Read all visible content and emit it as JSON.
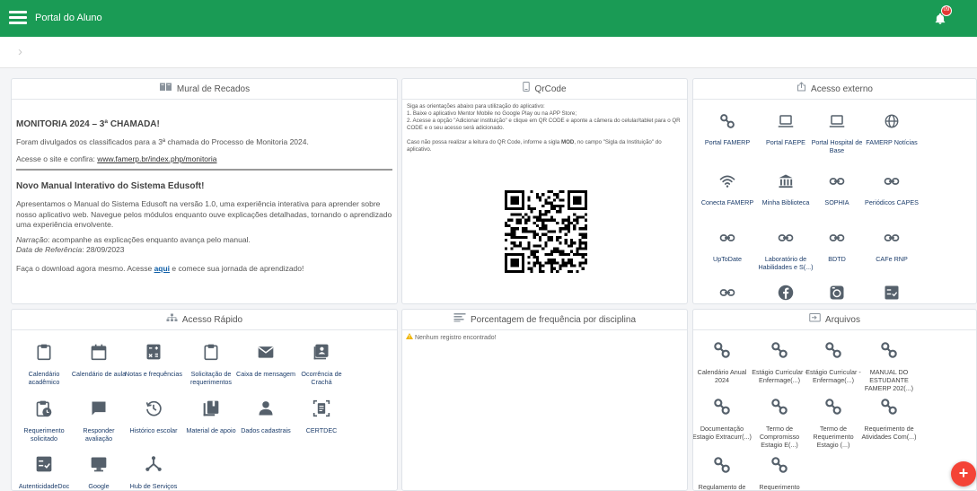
{
  "app": {
    "title": "Portal do Aluno",
    "notification_count": "09"
  },
  "mural": {
    "title": "Mural de Recados",
    "post1_title": "MONITORIA 2024 – 3ª CHAMADA!",
    "post1_body": "Foram divulgados os classificados para a 3ª chamada do Processo de Monitoria 2024.",
    "post1_link_prefix": "Acesse o site e confira: ",
    "post1_link": "www.famerp.br/index.php/monitoria",
    "post2_title": "Novo Manual Interativo do Sistema Edusoft!",
    "post2_body": "Apresentamos o Manual do Sistema Edusoft na versão 1.0, uma experiência interativa para aprender sobre nosso aplicativo web. Navegue pelos módulos enquanto ouve explicações detalhadas, tornando o aprendizado uma experiência envolvente.",
    "post2_narracao_label": "Narração",
    "post2_narracao": ": acompanhe as explicações enquanto avança pelo manual.",
    "post2_data_label": "Data de Referência",
    "post2_data": ": 28/09/2023",
    "post2_download_prefix": "Faça o download agora mesmo. Acesse ",
    "post2_download_link": "aqui",
    "post2_download_suffix": " e comece sua jornada de aprendizado!"
  },
  "qrcode": {
    "title": "QrCode",
    "line1": "Siga as orientações abaixo para utilização do aplicativo:",
    "line2": "1. Baixe o aplicativo Mentor Mobile no Google Play ou na APP Store;",
    "line3": "2. Acesse a opção \"Adicionar instituição\" e clique em QR CODE e aponte a câmera do celular/tablet para o QR CODE e o seu acesso será adicionado.",
    "line4_prefix": "Caso não possa realizar a leitura do QR Code, informe a sigla ",
    "line4_sigla": "MOD",
    "line4_suffix": ", no campo \"Sigla da Instituição\" do aplicativo."
  },
  "acesso_externo": {
    "title": "Acesso externo",
    "items": [
      {
        "label": "Portal FAMERP",
        "icon": "link-icon"
      },
      {
        "label": "Portal FAEPE",
        "icon": "laptop-icon"
      },
      {
        "label": "Portal Hospital de Base",
        "icon": "laptop-icon"
      },
      {
        "label": "FAMERP Notícias",
        "icon": "globe-icon"
      },
      {
        "label": "Conecta FAMERP",
        "icon": "wifi-icon"
      },
      {
        "label": "Minha Biblioteca",
        "icon": "bank-icon"
      },
      {
        "label": "SOPHIA",
        "icon": "chain-icon"
      },
      {
        "label": "Periódicos CAPES",
        "icon": "chain-icon"
      },
      {
        "label": "UpToDate",
        "icon": "chain-icon"
      },
      {
        "label": "Laboratório de Habilidades e S(...)",
        "icon": "chain-icon"
      },
      {
        "label": "BDTD",
        "icon": "chain-icon"
      },
      {
        "label": "CAFe RNP",
        "icon": "chain-icon"
      },
      {
        "label": "",
        "icon": "chain-icon"
      },
      {
        "label": "",
        "icon": "facebook-icon"
      },
      {
        "label": "",
        "icon": "instagram-icon"
      },
      {
        "label": "",
        "icon": "checklist-icon"
      }
    ]
  },
  "acesso_rapido": {
    "title": "Acesso Rápido",
    "items": [
      {
        "label": "Calendário acadêmico",
        "icon": "clipboard-icon"
      },
      {
        "label": "Calendário de aula",
        "icon": "calendar-icon"
      },
      {
        "label": "Notas e frequências",
        "icon": "calculator-icon"
      },
      {
        "label": "Solicitação de requerimentos",
        "icon": "clipboard-icon"
      },
      {
        "label": "Caixa de mensagem",
        "icon": "mail-icon"
      },
      {
        "label": "Ocorrência de Crachá",
        "icon": "badge-icon"
      },
      {
        "label": "Requerimento solicitado",
        "icon": "clipboard-clock-icon"
      },
      {
        "label": "Responder avaliação",
        "icon": "chat-icon"
      },
      {
        "label": "Histórico escolar",
        "icon": "history-icon"
      },
      {
        "label": "Material de apoio",
        "icon": "books-icon"
      },
      {
        "label": "Dados cadastrais",
        "icon": "person-icon"
      },
      {
        "label": "CERTDEC",
        "icon": "certificate-icon"
      },
      {
        "label": "AutenticidadeDoc",
        "icon": "checklist-icon"
      },
      {
        "label": "Google",
        "icon": "monitor-icon"
      },
      {
        "label": "Hub de Serviços",
        "icon": "hub-icon"
      }
    ]
  },
  "frequencia": {
    "title": "Porcentagem de frequência por disciplina",
    "empty_message": "Nenhum registro encontrado!"
  },
  "arquivos": {
    "title": "Arquivos",
    "items": [
      {
        "label": "Calendário Anual 2024",
        "icon": "link-icon"
      },
      {
        "label": "Estágio Curricular - Enfermage(...)",
        "icon": "link-icon"
      },
      {
        "label": "Estágio Curricular - Enfermage(...)",
        "icon": "link-icon"
      },
      {
        "label": "MANUAL DO ESTUDANTE FAMERP 202(...)",
        "icon": "link-icon"
      },
      {
        "label": "Documentação Estagio Extracurr(...)",
        "icon": "link-icon"
      },
      {
        "label": "Termo de Compromisso Estagio E(...)",
        "icon": "link-icon"
      },
      {
        "label": "Termo de Requerimento Estagio (...)",
        "icon": "link-icon"
      },
      {
        "label": "Requerimento de Atividades Com(...)",
        "icon": "link-icon"
      },
      {
        "label": "Regulamento de",
        "icon": "link-icon"
      },
      {
        "label": "Requerimento",
        "icon": "link-icon"
      }
    ]
  },
  "colors": {
    "topbar": "#1a9b55",
    "icon": "#4a5560",
    "link": "#1c3d6b",
    "fab": "#f44336"
  }
}
